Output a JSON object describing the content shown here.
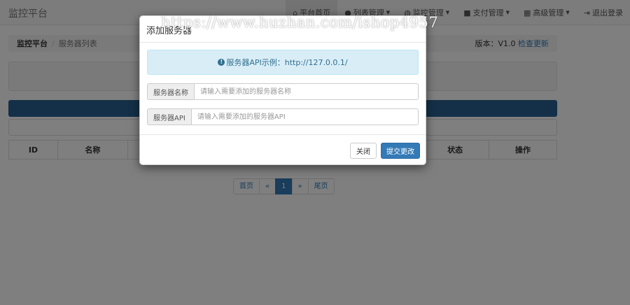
{
  "navbar": {
    "brand": "监控平台",
    "items": [
      {
        "icon": "home-icon",
        "glyph": "⌂",
        "label": "平台首页",
        "caret": false,
        "active": true
      },
      {
        "icon": "user-icon",
        "glyph": "●",
        "label": "列表管理",
        "caret": true
      },
      {
        "icon": "globe-icon",
        "glyph": "◍",
        "label": "监控管理",
        "caret": true
      },
      {
        "icon": "briefcase-icon",
        "glyph": "■",
        "label": "支付管理",
        "caret": true
      },
      {
        "icon": "grid-icon",
        "glyph": "▦",
        "label": "高级管理",
        "caret": true
      },
      {
        "icon": "logout-icon",
        "glyph": "⇥",
        "label": "退出登录",
        "caret": false
      }
    ]
  },
  "breadcrumb": {
    "home": "监控平台",
    "current": "服务器列表",
    "version_label": "版本：V1.0",
    "update_link": "检查更新"
  },
  "table": {
    "headers": [
      "ID",
      "名称",
      "",
      "",
      "状态",
      "操作"
    ]
  },
  "pagination": {
    "first": "首页",
    "prev": "«",
    "current": "1",
    "next": "»",
    "last": "尾页"
  },
  "modal": {
    "title": "添加服务器",
    "alert_text": "服务器API示例：http://127.0.0.1/",
    "name_label": "服务器名称",
    "name_placeholder": "请输入需要添加的服务器名称",
    "api_label": "服务器API",
    "api_placeholder": "请输入需要添加的服务器API",
    "close_label": "关闭",
    "submit_label": "提交更改"
  },
  "watermark": "https://www.huzhan.com/ishop4957",
  "colors": {
    "primary": "#337ab7",
    "alert_bg": "#d9edf7",
    "alert_text": "#31708f",
    "progress": "#286090"
  }
}
